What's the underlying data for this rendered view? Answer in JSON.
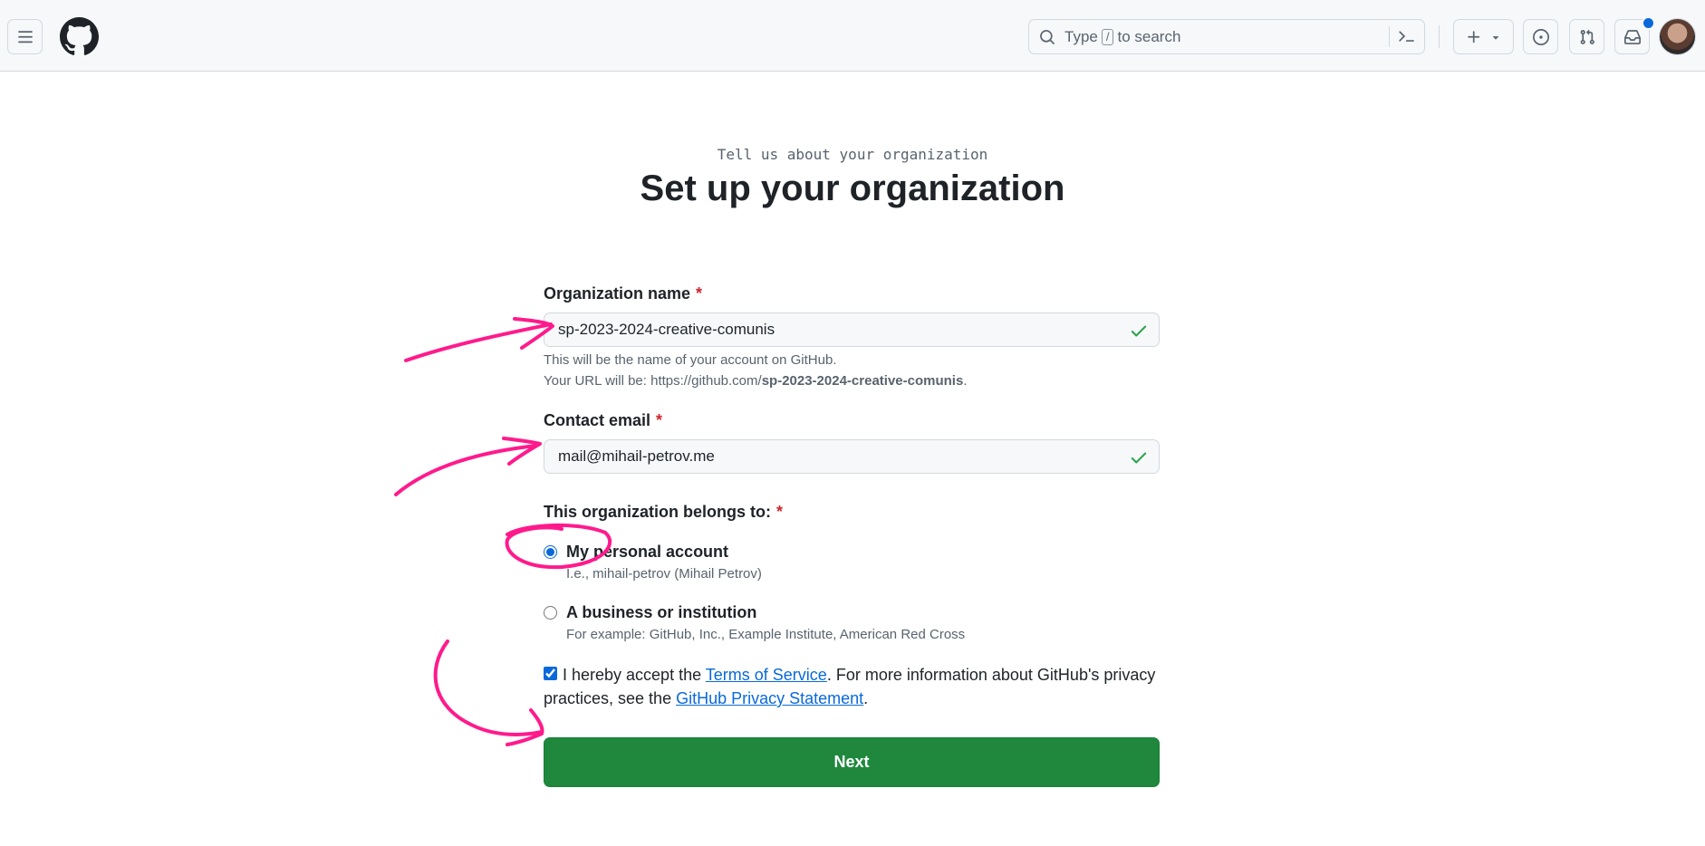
{
  "header": {
    "search_prefix": "Type",
    "search_key": "/",
    "search_suffix": "to search"
  },
  "page": {
    "subtitle": "Tell us about your organization",
    "title": "Set up your organization"
  },
  "form": {
    "org_name": {
      "label": "Organization name",
      "required_mark": "*",
      "value": "sp-2023-2024-creative-comunis",
      "note_line1": "This will be the name of your account on GitHub.",
      "note_url_prefix": "Your URL will be: https://github.com/",
      "note_url_slug": "sp-2023-2024-creative-comunis",
      "note_url_suffix": "."
    },
    "contact_email": {
      "label": "Contact email",
      "required_mark": "*",
      "value": "mail@mihail-petrov.me"
    },
    "belongs_to": {
      "label": "This organization belongs to:",
      "required_mark": "*",
      "options": [
        {
          "label": "My personal account",
          "note": "I.e., mihail-petrov (Mihail Petrov)",
          "checked": true
        },
        {
          "label": "A business or institution",
          "note": "For example: GitHub, Inc., Example Institute, American Red Cross",
          "checked": false
        }
      ]
    },
    "terms": {
      "checked": true,
      "text_before": "I hereby accept the ",
      "terms_link": "Terms of Service",
      "text_middle": ". For more information about GitHub's privacy practices, see the ",
      "privacy_link": "GitHub Privacy Statement",
      "text_after": "."
    },
    "next_button": "Next"
  },
  "colors": {
    "accent": "#0969da",
    "primary_button": "#1f883d",
    "valid_check": "#1a7f37",
    "required": "#d1242f",
    "annotation": "#ff1a8c"
  }
}
